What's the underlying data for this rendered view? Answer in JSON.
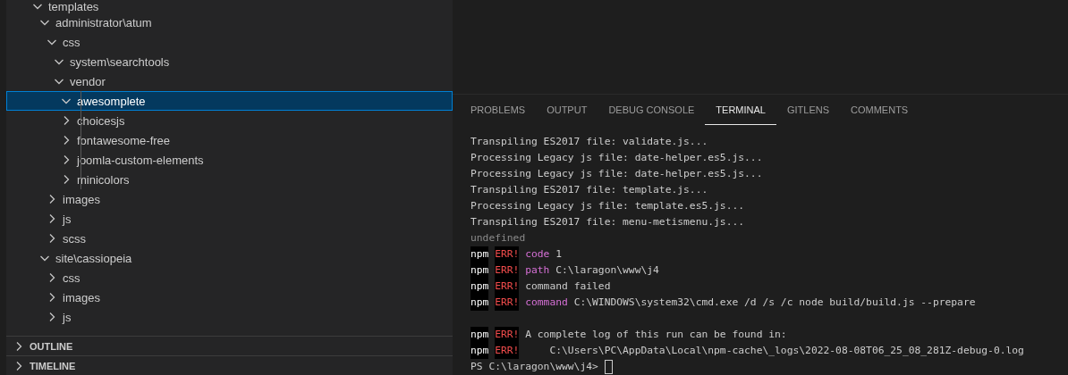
{
  "explorer": {
    "tree": [
      {
        "label": "templates",
        "expanded": true,
        "selected": false,
        "children": [
          {
            "label": "administrator\\atum",
            "expanded": true,
            "selected": false,
            "children": [
              {
                "label": "css",
                "expanded": true,
                "selected": false,
                "children": [
                  {
                    "label": "system\\searchtools",
                    "expanded": true,
                    "selected": false
                  },
                  {
                    "label": "vendor",
                    "expanded": true,
                    "selected": false,
                    "children": [
                      {
                        "label": "awesomplete",
                        "expanded": true,
                        "selected": true
                      },
                      {
                        "label": "choicesjs",
                        "expanded": false,
                        "selected": false
                      },
                      {
                        "label": "fontawesome-free",
                        "expanded": false,
                        "selected": false
                      },
                      {
                        "label": "joomla-custom-elements",
                        "expanded": false,
                        "selected": false
                      },
                      {
                        "label": "minicolors",
                        "expanded": false,
                        "selected": false
                      }
                    ]
                  }
                ]
              },
              {
                "label": "images",
                "expanded": false,
                "selected": false
              },
              {
                "label": "js",
                "expanded": false,
                "selected": false
              },
              {
                "label": "scss",
                "expanded": false,
                "selected": false
              }
            ]
          },
          {
            "label": "site\\cassiopeia",
            "expanded": true,
            "selected": false,
            "children": [
              {
                "label": "css",
                "expanded": false,
                "selected": false
              },
              {
                "label": "images",
                "expanded": false,
                "selected": false
              },
              {
                "label": "js",
                "expanded": false,
                "selected": false
              }
            ]
          }
        ]
      }
    ],
    "sections": [
      {
        "label": "OUTLINE",
        "expanded": false
      },
      {
        "label": "TIMELINE",
        "expanded": false
      }
    ]
  },
  "panel": {
    "tabs": [
      {
        "label": "PROBLEMS",
        "selected": false
      },
      {
        "label": "OUTPUT",
        "selected": false
      },
      {
        "label": "DEBUG CONSOLE",
        "selected": false
      },
      {
        "label": "TERMINAL",
        "selected": true
      },
      {
        "label": "GITLENS",
        "selected": false
      },
      {
        "label": "COMMENTS",
        "selected": false
      }
    ],
    "terminal": [
      {
        "kind": "plain",
        "text": "Transpiling ES2017 file: validate.js..."
      },
      {
        "kind": "plain",
        "text": "Processing Legacy js file: date-helper.es5.js..."
      },
      {
        "kind": "plain",
        "text": "Processing Legacy js file: date-helper.es5.js..."
      },
      {
        "kind": "plain",
        "text": "Transpiling ES2017 file: template.js..."
      },
      {
        "kind": "plain",
        "text": "Processing Legacy js file: template.es5.js..."
      },
      {
        "kind": "plain",
        "text": "Transpiling ES2017 file: menu-metismenu.js..."
      },
      {
        "kind": "muted",
        "text": "undefined"
      },
      {
        "kind": "npm",
        "prefix": "npm",
        "tag": "ERR!",
        "keyword": "code",
        "text": "1"
      },
      {
        "kind": "npm",
        "prefix": "npm",
        "tag": "ERR!",
        "keyword": "path",
        "text": "C:\\laragon\\www\\j4"
      },
      {
        "kind": "npm",
        "prefix": "npm",
        "tag": "ERR!",
        "text": "command failed"
      },
      {
        "kind": "npm",
        "prefix": "npm",
        "tag": "ERR!",
        "keyword": "command",
        "text": "C:\\WINDOWS\\system32\\cmd.exe /d /s /c node build/build.js --prepare"
      },
      {
        "kind": "blank"
      },
      {
        "kind": "npm",
        "prefix": "npm",
        "tag": "ERR!",
        "text": "A complete log of this run can be found in:"
      },
      {
        "kind": "npm",
        "prefix": "npm",
        "tag": "ERR!",
        "text": "    C:\\Users\\PC\\AppData\\Local\\npm-cache\\_logs\\2022-08-08T06_25_08_281Z-debug-0.log"
      },
      {
        "kind": "prompt",
        "text": "PS C:\\laragon\\www\\j4>"
      }
    ]
  }
}
